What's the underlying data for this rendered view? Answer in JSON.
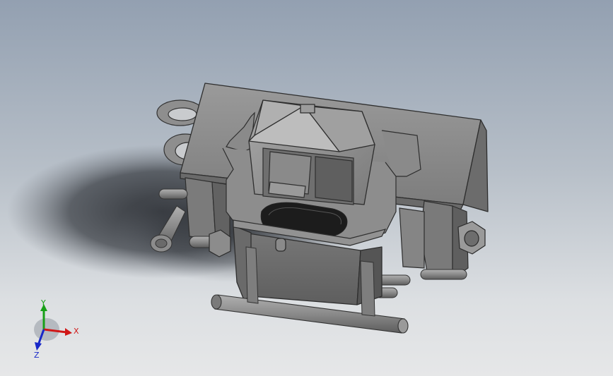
{
  "scene": {
    "background_top": "#93a0b1",
    "background_bottom": "#e6e7e8",
    "part_color": "#8f8f8f"
  },
  "triad": {
    "x_label": "X",
    "y_label": "Y",
    "z_label": "Z",
    "x_color": "#d01818",
    "y_color": "#18a018",
    "z_color": "#1828c8"
  }
}
